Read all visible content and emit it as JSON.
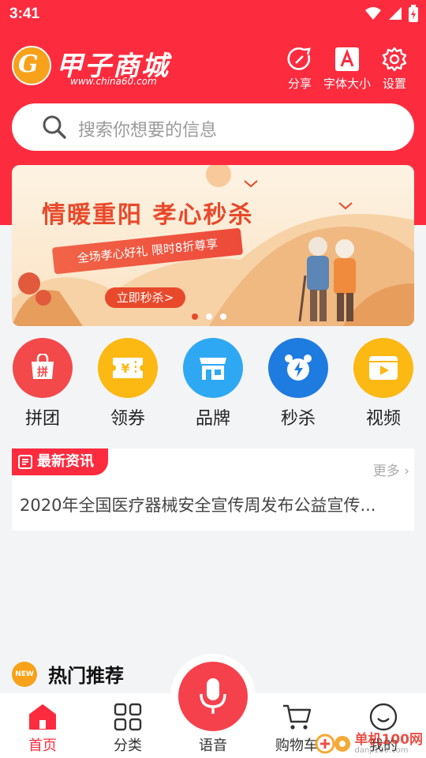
{
  "status": {
    "time": "3:41"
  },
  "header": {
    "logo_text": "甲子商城",
    "logo_url": "www.china60.com",
    "tools": [
      {
        "label": "分享",
        "icon": "share-icon"
      },
      {
        "label": "字体大小",
        "icon": "font-size-icon"
      },
      {
        "label": "设置",
        "icon": "gear-icon"
      }
    ]
  },
  "search": {
    "placeholder": "搜索你想要的信息"
  },
  "banner": {
    "title": "情暖重阳 孝心秒杀",
    "ribbon": "全场孝心好礼 限时8折尊享",
    "button": "立即秒杀>",
    "active_slide": 1,
    "slide_count": 3
  },
  "categories": [
    {
      "label": "拼团",
      "icon": "group-buy-icon",
      "color": "#f3494a"
    },
    {
      "label": "领券",
      "icon": "coupon-icon",
      "color": "#fcb813"
    },
    {
      "label": "品牌",
      "icon": "brand-store-icon",
      "color": "#2ea8f3"
    },
    {
      "label": "秒杀",
      "icon": "alarm-clock-icon",
      "color": "#1e7be0"
    },
    {
      "label": "视频",
      "icon": "video-icon",
      "color": "#fcb813"
    }
  ],
  "news": {
    "tag": "最新资讯",
    "more": "更多",
    "headline": "2020年全国医疗器械安全宣传周发布公益宣传..."
  },
  "hot": {
    "badge": "NEW",
    "title": "热门推荐"
  },
  "tabs": [
    {
      "label": "首页",
      "icon": "home-icon",
      "active": true
    },
    {
      "label": "分类",
      "icon": "grid-icon",
      "active": false
    },
    {
      "label": "语音",
      "icon": "microphone-icon",
      "active": false
    },
    {
      "label": "购物车",
      "icon": "cart-icon",
      "active": false
    },
    {
      "label": "我的",
      "icon": "smile-icon",
      "active": false
    }
  ],
  "watermark": {
    "title": "单机100网",
    "url": "danji100.com"
  },
  "colors": {
    "brand": "#fd2b3e",
    "accent": "#f7a21a"
  }
}
